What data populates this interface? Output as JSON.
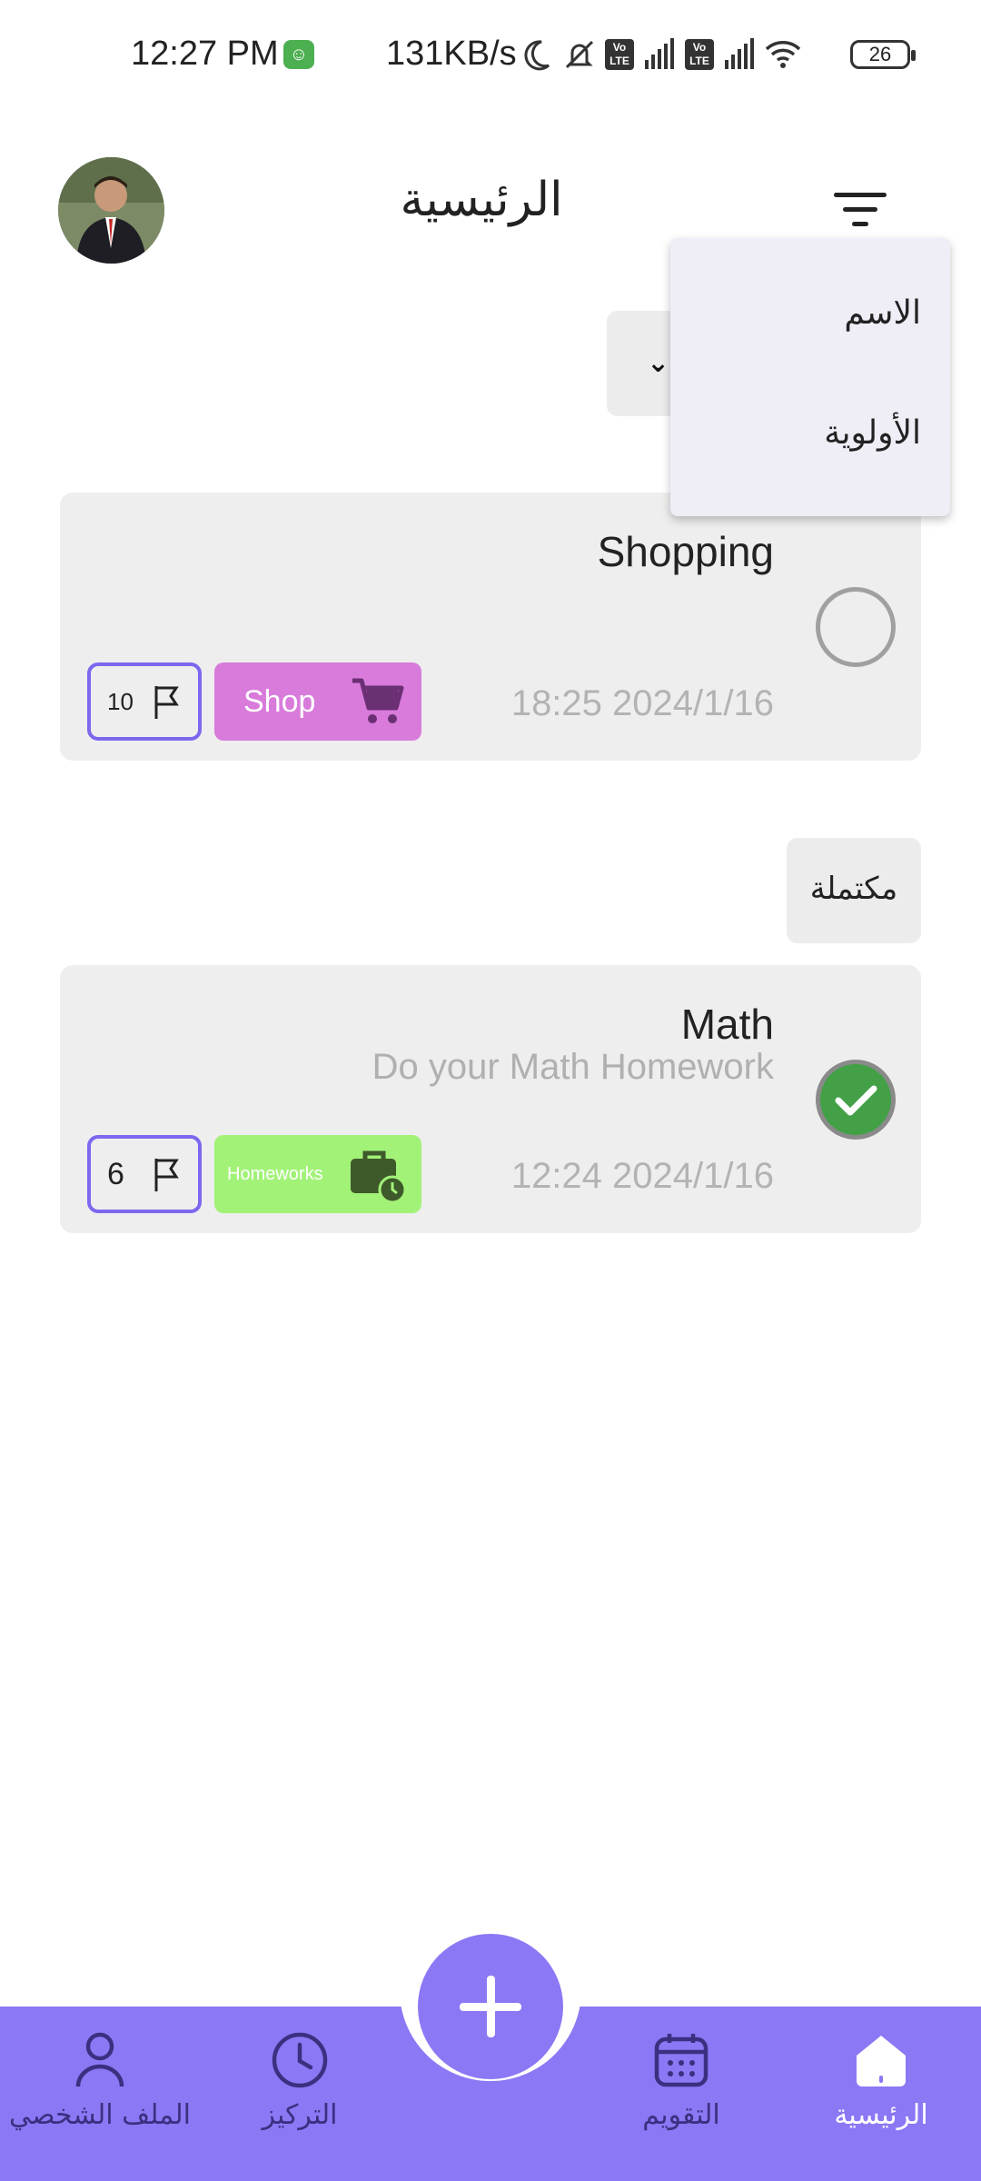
{
  "status_bar": {
    "time": "12:27 PM",
    "network_speed": "131KB/s",
    "battery": "26",
    "icons": [
      "moon-icon",
      "bell-off-icon",
      "volte-icon",
      "signal-icon",
      "volte-icon",
      "signal-icon",
      "wifi-icon"
    ]
  },
  "header": {
    "title": "الرئيسية",
    "filter_icon": "filter-icon",
    "avatar": "avatar"
  },
  "sort_menu": {
    "options": [
      "الاسم",
      "الأولوية"
    ]
  },
  "tasks_pending": [
    {
      "title": "Shopping",
      "description": "",
      "date": "18:25 2024/1/16",
      "priority": "10",
      "category": "Shop",
      "category_color": "#d87bdb",
      "category_icon": "cart-icon",
      "completed": false
    }
  ],
  "completed_section": {
    "label": "مكتملة"
  },
  "tasks_completed": [
    {
      "title": "Math",
      "description": "Do your Math Homework",
      "date": "12:24 2024/1/16",
      "priority": "6",
      "category": "Homeworks",
      "category_color": "#a2f278",
      "category_icon": "briefcase-clock-icon",
      "completed": true
    }
  ],
  "bottom_nav": {
    "items": [
      {
        "label": "الملف الشخصي",
        "icon": "person-icon"
      },
      {
        "label": "التركيز",
        "icon": "clock-icon"
      },
      {
        "label": "التقويم",
        "icon": "calendar-icon"
      },
      {
        "label": "الرئيسية",
        "icon": "home-icon"
      }
    ],
    "active": "الرئيسية",
    "add_button_icon": "plus-icon"
  },
  "colors": {
    "accent": "#8b78f5",
    "priority_border": "#7b68ee",
    "card_bg": "#eeeeee",
    "done_green": "#43a047"
  }
}
